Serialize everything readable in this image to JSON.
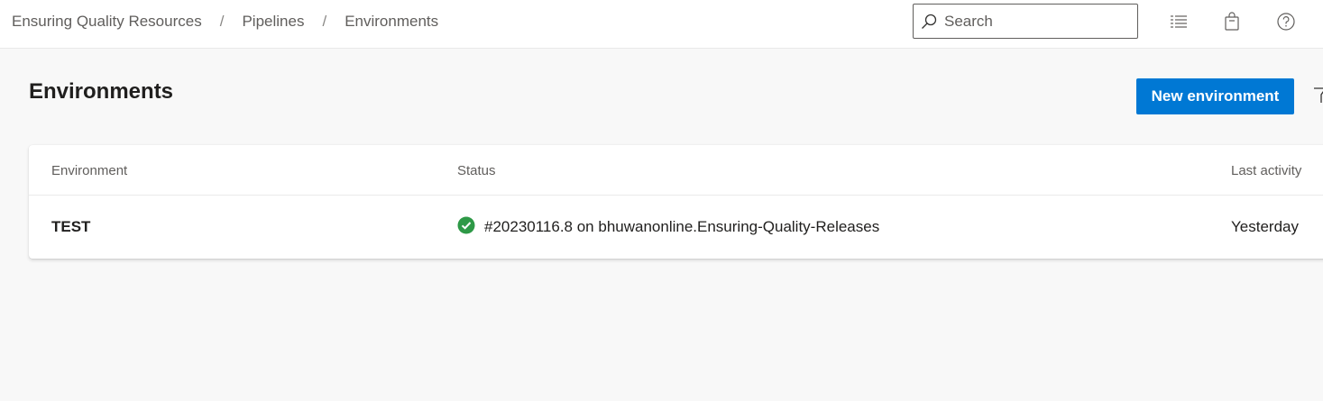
{
  "header": {
    "breadcrumb": [
      "Ensuring Quality Resources",
      "Pipelines",
      "Environments"
    ],
    "breadcrumb_separator": "/",
    "search_placeholder": "Search",
    "icons": [
      "list-icon",
      "shopping-bag-icon",
      "help-icon"
    ]
  },
  "page": {
    "title": "Environments",
    "new_button_label": "New environment"
  },
  "table": {
    "columns": [
      "Environment",
      "Status",
      "Last activity"
    ],
    "rows": [
      {
        "environment": "TEST",
        "status_icon": "success-check-icon",
        "status_text": "#20230116.8 on bhuwanonline.Ensuring-Quality-Releases",
        "last_activity": "Yesterday"
      }
    ]
  },
  "colors": {
    "accent": "#0078d4",
    "success": "#2e9947",
    "background": "#f8f8f8"
  }
}
